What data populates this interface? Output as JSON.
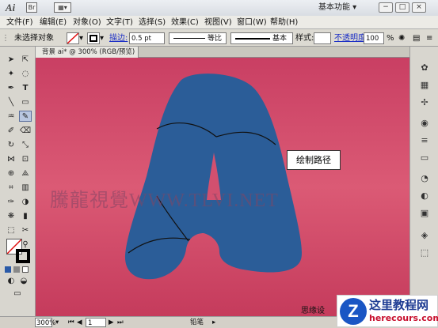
{
  "app": {
    "logo": "Ai",
    "workspace": "基本功能 ▾"
  },
  "window_buttons": [
    "−",
    "□",
    "×"
  ],
  "menu": [
    "文件(F)",
    "编辑(E)",
    "对象(O)",
    "文字(T)",
    "选择(S)",
    "效果(C)",
    "视图(V)",
    "窗口(W)",
    "帮助(H)"
  ],
  "control_bar": {
    "selection_label": "未选择对象",
    "stroke_label": "描边:",
    "stroke_weight": "0.5 pt",
    "profile_label": "等比",
    "brush_label": "基本",
    "style_label": "样式:",
    "opacity_label": "不透明度:",
    "opacity_value": "100",
    "percent": "%"
  },
  "document_tab": "背景  ai* @ 300% (RGB/预览)",
  "canvas": {
    "watermark": "騰龍視覺WWW.TLVI.NET",
    "callout": "绘制路径"
  },
  "status_bar": {
    "zoom": "300%",
    "page": "1",
    "tool": "铅笔"
  },
  "bottom_text": "思缘设",
  "corner_logo": {
    "letter": "Z",
    "name": "这里教程网",
    "url": "herecours.com"
  },
  "colors": {
    "letter_fill": "#2b5d98",
    "canvas_top": "#c93f63",
    "canvas_mid": "#db5a75",
    "link": "#1c2fc6"
  }
}
